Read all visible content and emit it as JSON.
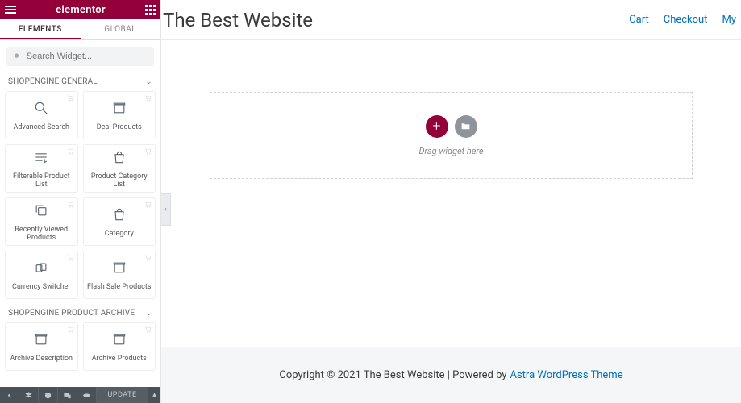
{
  "header": {
    "brand": "elementor"
  },
  "tabs": {
    "elements": "ELEMENTS",
    "global": "GLOBAL"
  },
  "search": {
    "placeholder": "Search Widget..."
  },
  "categories": [
    {
      "title": "SHOPENGINE GENERAL",
      "widgets": [
        {
          "label": "Advanced Search",
          "icon": "search"
        },
        {
          "label": "Deal Products",
          "icon": "box"
        },
        {
          "label": "Filterable Product List",
          "icon": "filter"
        },
        {
          "label": "Product Category List",
          "icon": "bag"
        },
        {
          "label": "Recently Viewed Products",
          "icon": "copy"
        },
        {
          "label": "Category",
          "icon": "bag"
        },
        {
          "label": "Currency Switcher",
          "icon": "currency"
        },
        {
          "label": "Flash Sale Products",
          "icon": "box"
        }
      ]
    },
    {
      "title": "SHOPENGINE PRODUCT ARCHIVE",
      "widgets": [
        {
          "label": "Archive Description",
          "icon": "box"
        },
        {
          "label": "Archive Products",
          "icon": "box"
        }
      ]
    }
  ],
  "bottombar": {
    "update": "UPDATE"
  },
  "site": {
    "title": "The Best Website",
    "nav": {
      "cart": "Cart",
      "checkout": "Checkout",
      "my": "My"
    },
    "drop": "Drag widget here",
    "footer_text": "Copyright © 2021 The Best Website | Powered by ",
    "footer_link": "Astra WordPress Theme"
  }
}
